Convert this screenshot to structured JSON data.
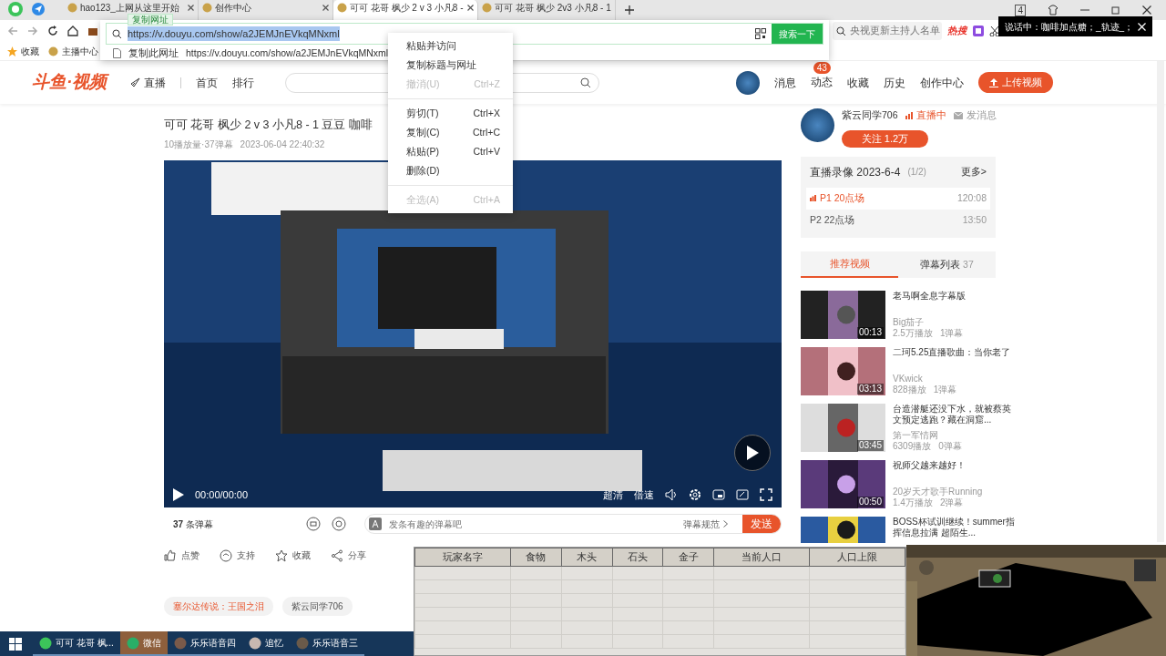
{
  "browser": {
    "tabs": [
      {
        "label": "hao123_上网从这里开始",
        "selected": false,
        "closable": true
      },
      {
        "label": "创作中心",
        "selected": false,
        "closable": true
      },
      {
        "label": "可可 花哥 枫少 2 v 3 小凡8 -",
        "selected": true,
        "closable": true
      },
      {
        "label": "可可 花哥 枫少 2v3 小凡8 - 1",
        "selected": false,
        "closable": false
      }
    ],
    "tab_count": "4",
    "address": {
      "value": "https://v.douyu.com/show/a2JEMJnEVkqMNxml",
      "tooltip": "复制网址",
      "suggestion_label": "复制此网址",
      "suggestion_url": "https://v.douyu.com/show/a2JEMJnEVkqMNxml",
      "search_button": "搜索一下"
    },
    "hot_search": {
      "placeholder": "央视更新主持人名单",
      "badge": "热搜"
    },
    "bookmarks": [
      "收藏",
      "主播中心"
    ]
  },
  "notification": {
    "text": "说话中：咖啡加点糖；_轨迹_；"
  },
  "context_menu": [
    {
      "kind": "item",
      "label": "粘贴并访问",
      "disabled": false
    },
    {
      "kind": "item",
      "label": "复制标题与网址",
      "disabled": false
    },
    {
      "kind": "item",
      "label": "撤消(U)",
      "shortcut": "Ctrl+Z",
      "disabled": true
    },
    {
      "kind": "separator"
    },
    {
      "kind": "item",
      "label": "剪切(T)",
      "shortcut": "Ctrl+X",
      "disabled": false
    },
    {
      "kind": "item",
      "label": "复制(C)",
      "shortcut": "Ctrl+C",
      "disabled": false
    },
    {
      "kind": "item",
      "label": "粘贴(P)",
      "shortcut": "Ctrl+V",
      "disabled": false
    },
    {
      "kind": "item",
      "label": "删除(D)",
      "disabled": false
    },
    {
      "kind": "separator"
    },
    {
      "kind": "item",
      "label": "全选(A)",
      "shortcut": "Ctrl+A",
      "disabled": true
    }
  ],
  "site": {
    "logo": "斗鱼·视频",
    "nav": [
      "直播",
      "首页",
      "排行"
    ],
    "user_nav": [
      {
        "label": "消息"
      },
      {
        "label": "动态",
        "badge": "43"
      },
      {
        "label": "收藏"
      },
      {
        "label": "历史"
      },
      {
        "label": "创作中心"
      }
    ],
    "upload": "上传视频"
  },
  "video": {
    "title": "可可 花哥 枫少 2 v 3 小凡8 - 1 豆豆 咖啡",
    "meta": "10播放量·37弹幕",
    "date": "2023-06-04 22:40:32",
    "time": "00:00/00:00",
    "quality": "超清",
    "speed": "倍速"
  },
  "danmaku": {
    "count": "37",
    "count_label": "条弹幕",
    "placeholder": "发条有趣的弹幕吧",
    "rules": "弹幕规范",
    "send": "发送"
  },
  "actions": [
    "点赞",
    "支持",
    "收藏",
    "分享"
  ],
  "tags": [
    {
      "label": "塞尔达传说：王国之泪",
      "highlighted": true
    },
    {
      "label": "紫云同学706",
      "highlighted": false
    }
  ],
  "uploader": {
    "name": "紫云同学706",
    "live": "直播中",
    "message": "发消息",
    "follow": "关注 1.2万"
  },
  "playlist": {
    "title": "直播录像 2023-6-4",
    "page": "(1/2)",
    "more": "更多>",
    "items": [
      {
        "label": "P1 20点场",
        "duration": "120:08",
        "selected": true
      },
      {
        "label": "P2 22点场",
        "duration": "13:50",
        "selected": false
      }
    ]
  },
  "side_tabs": [
    {
      "label": "推荐视频",
      "selected": true
    },
    {
      "label": "弹幕列表",
      "count": "37",
      "selected": false
    }
  ],
  "recommendations": [
    {
      "title": "老马啊全息字幕版",
      "duration": "00:13",
      "author": "Big茄子",
      "plays": "2.5万播放",
      "comments": "1弹幕"
    },
    {
      "title": "二珂5.25直播歌曲：当你老了",
      "duration": "03:13",
      "author": "VKwick",
      "plays": "828播放",
      "comments": "1弹幕"
    },
    {
      "title": "台造潜艇还没下水，就被蔡英文预定逃跑？藏在洞窟...",
      "duration": "03:45",
      "author": "第一军情网",
      "plays": "6309播放",
      "comments": "0弹幕"
    },
    {
      "title": "祝师父越来越好！",
      "duration": "00:50",
      "author": "20岁天才歌手Running",
      "plays": "1.4万播放",
      "comments": "2弹幕"
    },
    {
      "title": "BOSS杯试训继续！summer指挥信息拉满 超陌生..."
    }
  ],
  "float_table": {
    "columns": [
      "玩家名字",
      "食物",
      "木头",
      "石头",
      "金子",
      "当前人口",
      "人口上限"
    ]
  },
  "taskbar": [
    {
      "label": "可可 花哥 枫...",
      "highlighted": false
    },
    {
      "label": "微信",
      "highlighted": true
    },
    {
      "label": "乐乐语音四",
      "highlighted": false
    },
    {
      "label": "追忆",
      "highlighted": false
    },
    {
      "label": "乐乐语音三",
      "highlighted": false
    }
  ]
}
